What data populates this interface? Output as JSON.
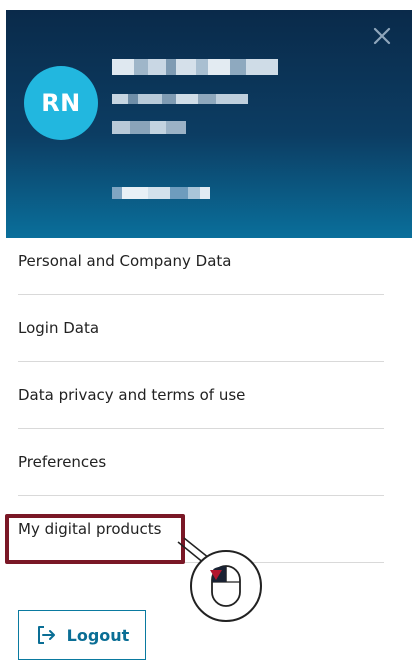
{
  "profile": {
    "initials": "RN",
    "close_icon": "close-icon"
  },
  "menu": {
    "items": [
      {
        "label": "Personal and Company Data"
      },
      {
        "label": "Login Data"
      },
      {
        "label": "Data privacy and terms of use"
      },
      {
        "label": "Preferences"
      },
      {
        "label": "My digital products"
      }
    ]
  },
  "logout": {
    "label": "Logout",
    "icon": "logout-icon"
  },
  "colors": {
    "header_top": "#0a2a4a",
    "header_bottom": "#0a6f9b",
    "avatar": "#22b7df",
    "highlight": "#7a1726",
    "accent": "#0a6e95"
  }
}
